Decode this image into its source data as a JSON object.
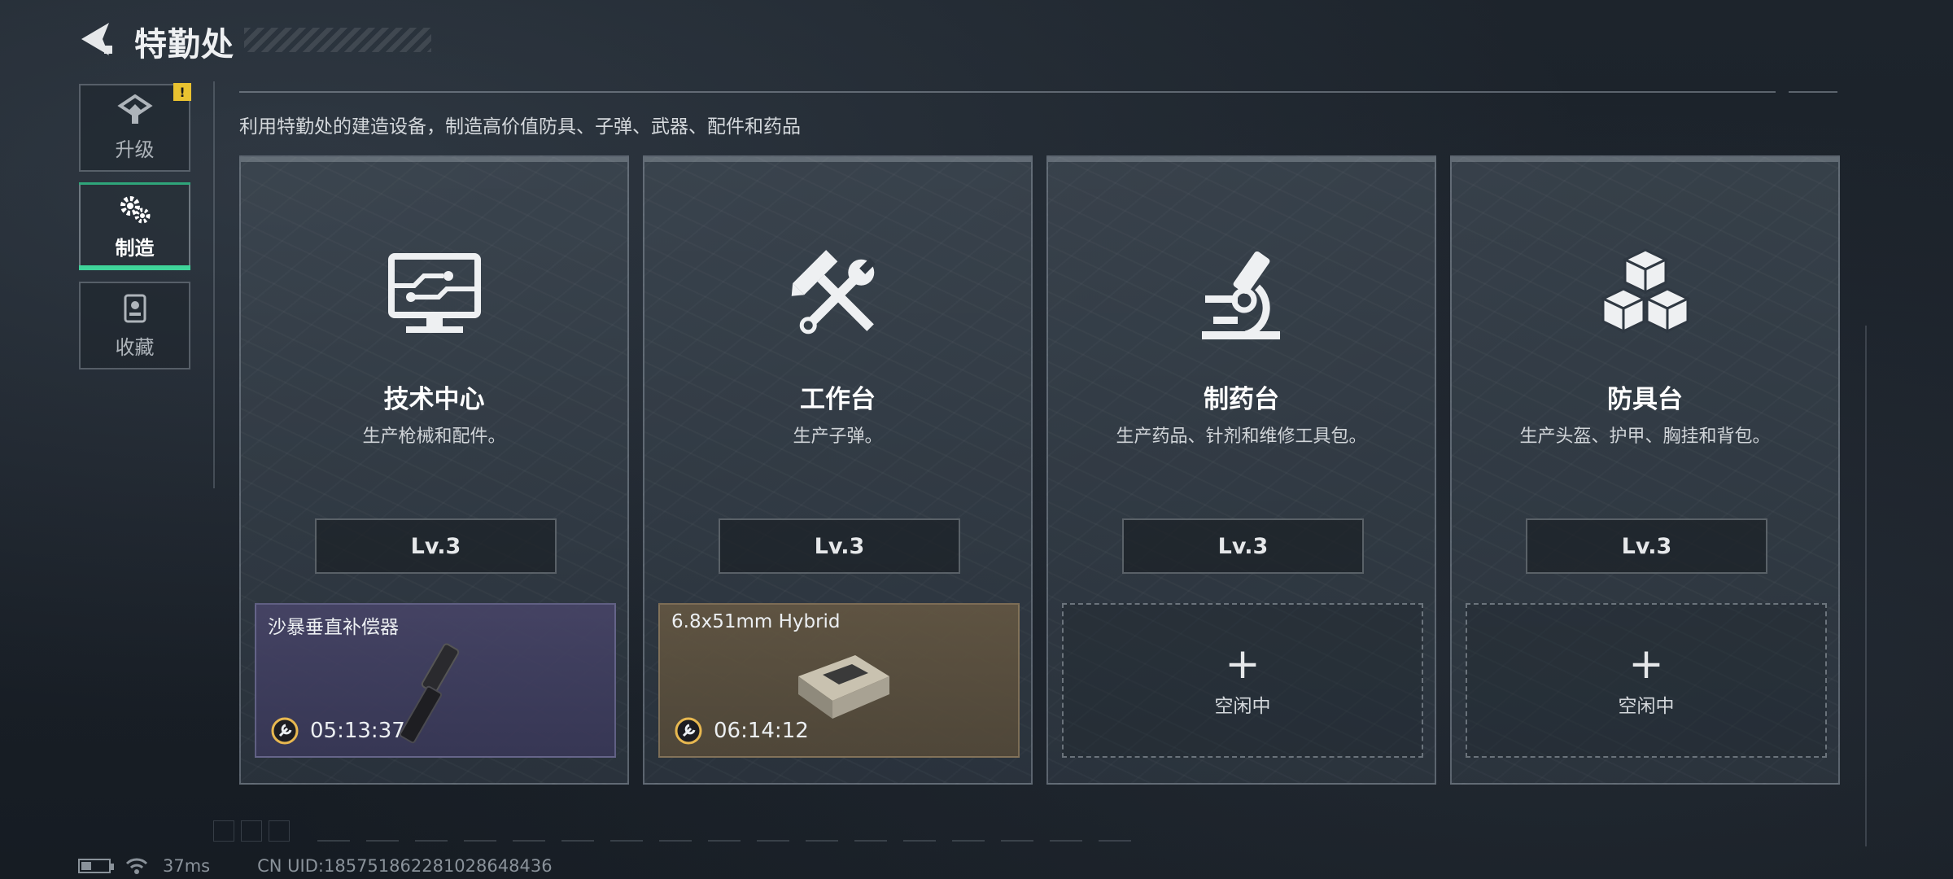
{
  "header": {
    "title": "特勤处"
  },
  "sidebar": {
    "items": [
      {
        "label": "升级",
        "icon": "upgrade-icon",
        "alert": "!"
      },
      {
        "label": "制造",
        "icon": "gears-icon",
        "active": true
      },
      {
        "label": "收藏",
        "icon": "collection-icon"
      }
    ]
  },
  "subtitle": "利用特勤处的建造设备，制造高价值防具、子弹、武器、配件和药品",
  "cards": [
    {
      "name": "技术中心",
      "desc": "生产枪械和配件。",
      "level": "Lv.3",
      "icon": "monitor-circuit-icon",
      "slot": {
        "state": "busy",
        "item": "沙暴垂直补偿器",
        "timer": "05:13:37",
        "item_icon": "compensator-icon"
      }
    },
    {
      "name": "工作台",
      "desc": "生产子弹。",
      "level": "Lv.3",
      "icon": "hammer-wrench-icon",
      "slot": {
        "state": "busy",
        "item": "6.8x51mm Hybrid",
        "timer": "06:14:12",
        "item_icon": "ammo-box-icon"
      }
    },
    {
      "name": "制药台",
      "desc": "生产药品、针剂和维修工具包。",
      "level": "Lv.3",
      "icon": "microscope-icon",
      "slot": {
        "state": "idle",
        "plus": "+",
        "label": "空闲中"
      }
    },
    {
      "name": "防具台",
      "desc": "生产头盔、护甲、胸挂和背包。",
      "level": "Lv.3",
      "icon": "cubes-icon",
      "slot": {
        "state": "idle",
        "plus": "+",
        "label": "空闲中"
      }
    }
  ],
  "footer": {
    "ping": "37ms",
    "uid": "CN UID:18575186228102864843​6"
  },
  "colors": {
    "accent": "#3fd49a",
    "alert": "#e9c230",
    "slot_a": "#464466",
    "slot_b": "#625642"
  }
}
